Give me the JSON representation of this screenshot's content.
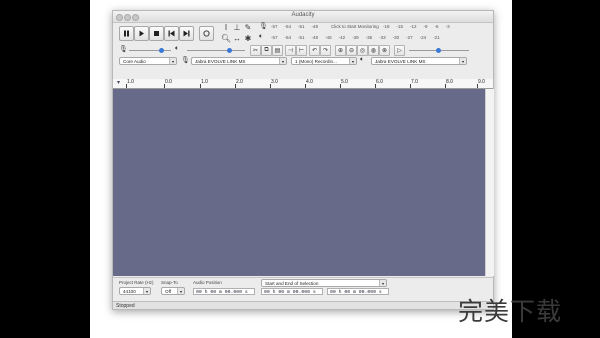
{
  "window": {
    "title": "Audacity"
  },
  "transport": {
    "icons": [
      "pause-icon",
      "play-icon",
      "stop-icon",
      "skip-start-icon",
      "skip-end-icon",
      "record-icon"
    ]
  },
  "tools": {
    "icons": [
      "selection-tool-icon",
      "envelope-tool-icon",
      "draw-tool-icon",
      "zoom-tool-icon",
      "timeshift-tool-icon",
      "multi-tool-icon"
    ]
  },
  "meters": {
    "record_prompt": "Click to Start Monitoring",
    "record_scale": [
      "-57",
      "-54",
      "-51",
      "-48",
      "-45",
      "-42"
    ],
    "record_scale_right": [
      "-18",
      "-15",
      "-12",
      "-9",
      "-6",
      "-3",
      "0"
    ],
    "play_scale": [
      "-57",
      "-54",
      "-51",
      "-48",
      "-45",
      "-42",
      "-39",
      "-36",
      "-33",
      "-30",
      "-27",
      "-24",
      "-21",
      "-18",
      "-15",
      "-12",
      "-9",
      "-6",
      "-3",
      "0"
    ]
  },
  "devices": {
    "host": "Core Audio",
    "recording_device": "Jabra EVOLVE LINK MS",
    "channels": "1 (Mono) Recordin...",
    "playback_device": "Jabra EVOLVE LINK MS"
  },
  "ruler": {
    "ticks": [
      "1.0",
      "0.0",
      "1.0",
      "2.0",
      "3.0",
      "4.0",
      "5.0",
      "6.0",
      "7.0",
      "8.0",
      "9.0"
    ]
  },
  "selection_toolbar": {
    "project_rate_label": "Project Rate (Hz)",
    "project_rate_value": "44100",
    "snap_to_label": "Snap-To",
    "snap_to_value": "Off",
    "audio_position_label": "Audio Position",
    "audio_position_value": "00 h 00 m 00.000 s",
    "selection_mode": "Start and End of Selection",
    "selection_start": "00 h 00 m 00.000 s",
    "selection_end": "00 h 00 m 00.000 s"
  },
  "status": {
    "text": "Stopped"
  },
  "watermark": {
    "text": "完美下载"
  },
  "colors": {
    "track_bg": "#686a8a",
    "accent": "#3a78d8"
  }
}
